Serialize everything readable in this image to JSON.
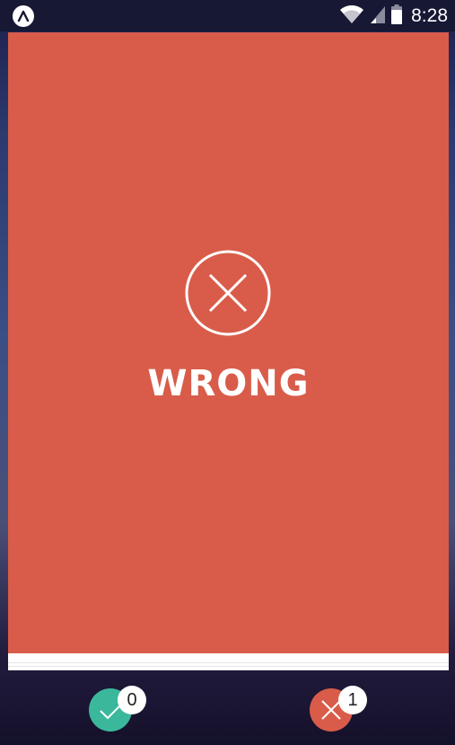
{
  "status_bar": {
    "app_icon": "expo-icon",
    "wifi_icon": "wifi-icon",
    "signal_icon": "signal-icon",
    "battery_icon": "battery-icon",
    "time": "8:28"
  },
  "result_card": {
    "icon": "close-circle-icon",
    "label": "WRONG",
    "color": "#d95c4a"
  },
  "scores": {
    "correct": {
      "icon": "check-icon",
      "count": "0",
      "color": "#3bb89b"
    },
    "wrong": {
      "icon": "close-icon",
      "count": "1",
      "color": "#d95c4a"
    }
  }
}
